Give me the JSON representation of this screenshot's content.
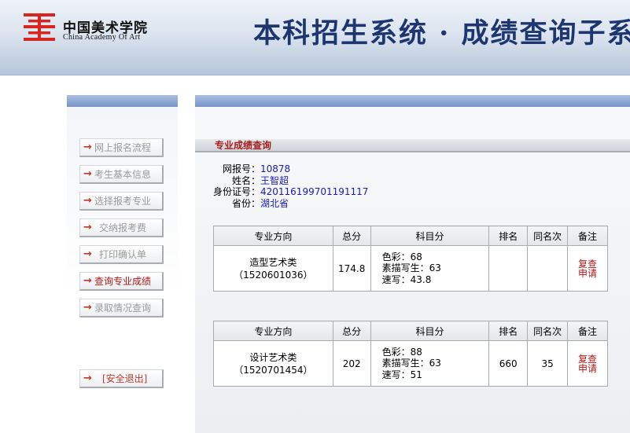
{
  "header": {
    "school_cn": "中国美术学院",
    "school_en": "China Academy Of Art",
    "system_title": "本科招生系统 · 成绩查询子系统"
  },
  "menu": {
    "items": [
      {
        "label": "网上报名流程"
      },
      {
        "label": "考生基本信息"
      },
      {
        "label": "选择报考专业"
      },
      {
        "label": "交纳报考费"
      },
      {
        "label": "打印确认单"
      },
      {
        "label": "查询专业成绩"
      },
      {
        "label": "录取情况查询"
      }
    ],
    "logout": "[安全退出]",
    "arrow": "→"
  },
  "main": {
    "section_title": "专业成绩查询",
    "info": [
      {
        "key": "网报号：",
        "value": "10878"
      },
      {
        "key": "姓名：",
        "value": "王智超"
      },
      {
        "key": "身份证号：",
        "value": "420116199701191117"
      },
      {
        "key": "省份：",
        "value": "湖北省"
      }
    ],
    "headers": [
      "专业方向",
      "总分",
      "科目分",
      "排名",
      "同名次",
      "备注"
    ],
    "results": [
      {
        "direction": "造型艺术类",
        "code": "（1520601036）",
        "total": "174.8",
        "subjects": [
          "色彩：68",
          "素描写生：63",
          "速写：43.8"
        ],
        "rank": "",
        "same_rank": "",
        "action": "复查申请"
      },
      {
        "direction": "设计艺术类",
        "code": "（1520701454）",
        "total": "202",
        "subjects": [
          "色彩：88",
          "素描写生：63",
          "速写：51"
        ],
        "rank": "660",
        "same_rank": "35",
        "action": "复查申请"
      }
    ]
  },
  "colors": {
    "title_blue": "#1e3670",
    "accent_red": "#b01818",
    "value_blue": "#1a1ab8",
    "bar_blue": "#7795c9"
  }
}
